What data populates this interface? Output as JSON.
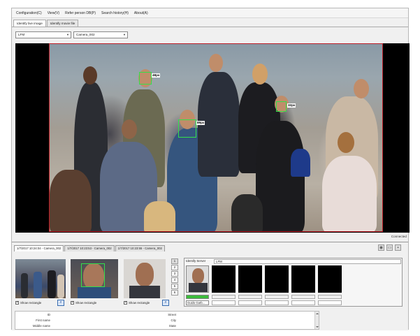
{
  "menu": [
    "Configuration(C)",
    "View(V)",
    "Refer person DB(P)",
    "Search history(H)",
    "About(A)"
  ],
  "tabs": [
    "Identify live image",
    "Identify movie file"
  ],
  "toolbar": {
    "server_select": "LFM",
    "camera_select": "Camera_002"
  },
  "video": {
    "face_labels": [
      "48px",
      "32px",
      "89px"
    ],
    "status": "Connected"
  },
  "history_tabs": [
    "1/7/2017 10:24:04 - Camera_002",
    "1/7/2017 10:23:53 - Camera_002",
    "1/7/2017 10:23:55 - Camera_002"
  ],
  "show_rectangle_label": "Show rectangle",
  "thumb_numbers": [
    "1",
    "2",
    "3",
    "4",
    "5",
    "6"
  ],
  "identify": {
    "server_label": "Identify Server",
    "server_value": "LFM",
    "progress_fraction": 1.0,
    "candidate_name": "Guido Garb..."
  },
  "details": {
    "left_fields": [
      "ID",
      "First name",
      "Middle name"
    ],
    "right_fields": [
      "Street",
      "City",
      "State"
    ]
  },
  "colors": {
    "face_box": "#33e04a",
    "frame_border": "#c0202a",
    "progress": "#3cbc3c"
  }
}
